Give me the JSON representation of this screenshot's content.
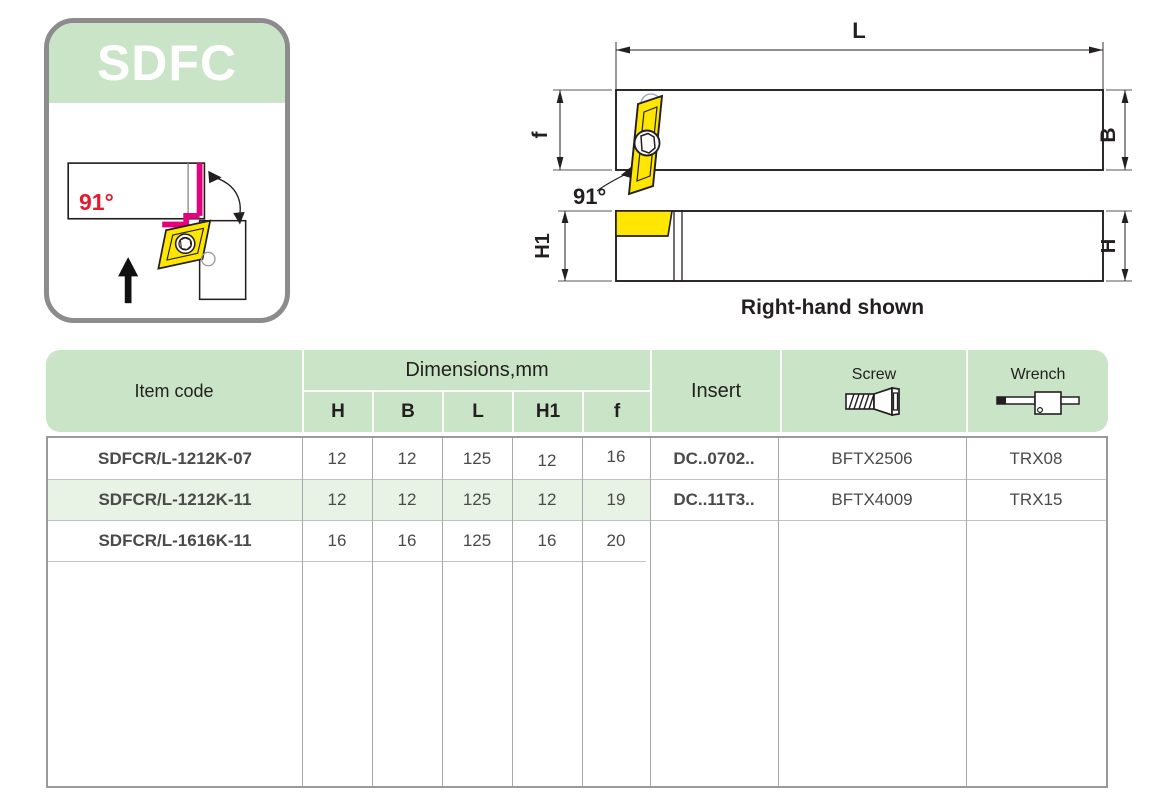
{
  "product": {
    "logo_title": "SDFC",
    "angle_label": "91°"
  },
  "drawings": {
    "top_view": {
      "dim_length": "L",
      "dim_width": "B",
      "dim_front": "f",
      "angle": "91°"
    },
    "side_view": {
      "dim_h1": "H1",
      "dim_h": "H"
    },
    "caption": "Right-hand shown"
  },
  "table": {
    "headers": {
      "item_code": "Item code",
      "dimensions_group": "Dimensions,mm",
      "dim_cols": [
        "H",
        "B",
        "L",
        "H1",
        "f"
      ],
      "insert": "Insert",
      "screw": "Screw",
      "wrench": "Wrench"
    },
    "rows": [
      {
        "item_code": "SDFCR/L-1212K-07",
        "H": "12",
        "B": "12",
        "L": "125",
        "H1": "12",
        "f": "16",
        "insert": "DC..0702..",
        "screw": "BFTX2506",
        "wrench": "TRX08",
        "highlighted": false
      },
      {
        "item_code": "SDFCR/L-1212K-11",
        "H": "12",
        "B": "12",
        "L": "125",
        "H1": "12",
        "f": "19",
        "insert": "DC..11T3..",
        "screw": "BFTX4009",
        "wrench": "TRX15",
        "highlighted": true
      },
      {
        "item_code": "SDFCR/L-1616K-11",
        "H": "16",
        "B": "16",
        "L": "125",
        "H1": "16",
        "f": "20",
        "insert": "",
        "screw": "",
        "wrench": "",
        "highlighted": false
      }
    ]
  },
  "colors": {
    "header_green": "#c9e4c6",
    "row_highlight": "#e9f3e5",
    "insert_yellow": "#ffe600",
    "accent_magenta": "#e6007e",
    "angle_red": "#e8192c",
    "card_border": "#8c8c8c",
    "table_border": "#9a9a9e"
  },
  "icons": {
    "screw": "screw-icon",
    "wrench": "wrench-icon"
  }
}
